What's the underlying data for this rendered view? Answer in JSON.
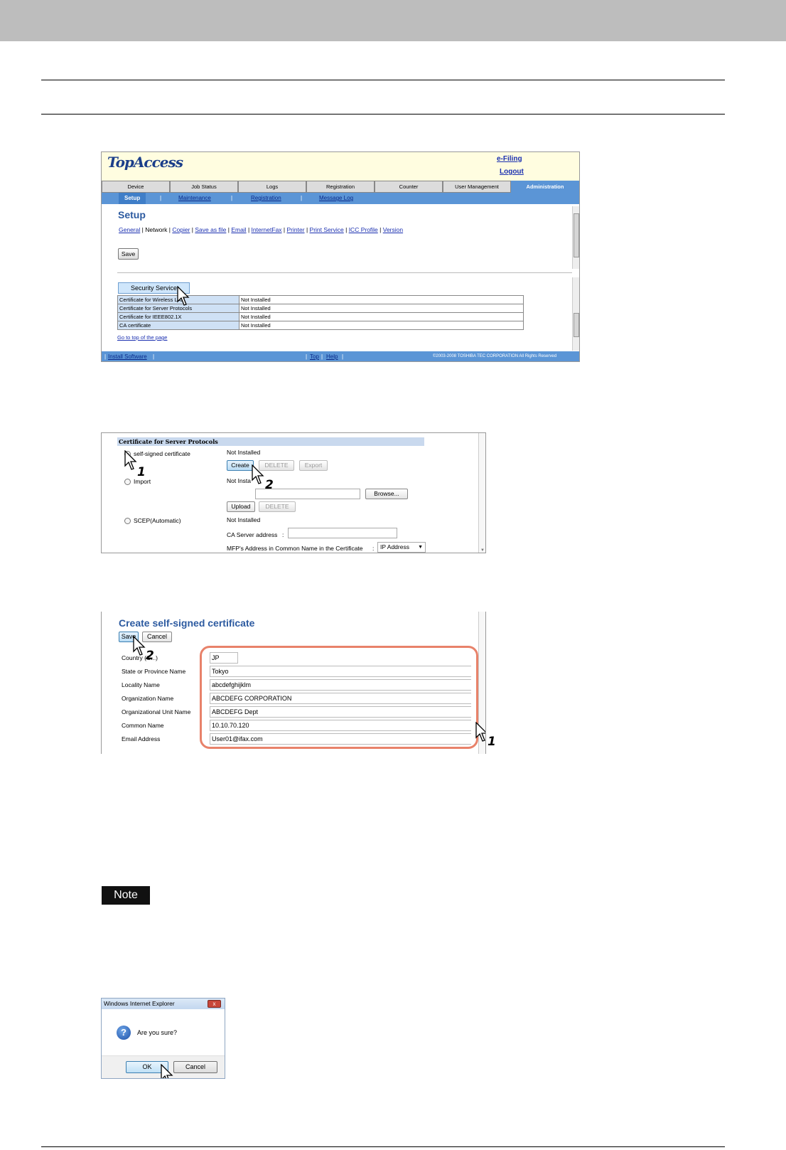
{
  "screen1": {
    "logo": "TopAccess",
    "links": {
      "efiling": "e-Filing",
      "logout": "Logout"
    },
    "tabs": [
      "Device",
      "Job Status",
      "Logs",
      "Registration",
      "Counter",
      "User Management",
      "Administration"
    ],
    "active_tab": "Administration",
    "subnav": {
      "current": "Setup",
      "items": [
        "Maintenance",
        "Registration",
        "Message Log"
      ],
      "sep": "|"
    },
    "page_title": "Setup",
    "menu": {
      "items": [
        "General",
        "Network",
        "Copier",
        "Save as file",
        "Email",
        "InternetFax",
        "Printer",
        "Print Service",
        "ICC Profile",
        "Version"
      ],
      "current": "Network",
      "sep": "|"
    },
    "save_label": "Save",
    "security_button": "Security Service",
    "table": [
      {
        "name": "Certificate for Wireless LAN",
        "status": "Not Installed"
      },
      {
        "name": "Certificate for Server Protocols",
        "status": "Not Installed"
      },
      {
        "name": "Certificate for IEEE802.1X",
        "status": "Not Installed"
      },
      {
        "name": "CA certificate",
        "status": "Not Installed"
      }
    ],
    "go_top": "Go to top of the page",
    "footer": {
      "install": "Install Software",
      "top": "Top",
      "help": "Help",
      "sep": "|",
      "copyright": "©2003-2008 TOSHIBA TEC CORPORATION All Rights Reserved"
    }
  },
  "screen2": {
    "header": "Certificate for Server Protocols",
    "options": [
      "self-signed certificate",
      "Import",
      "SCEP(Automatic)"
    ],
    "status_1": "Not Installed",
    "status_2": "Not Insta",
    "status_3": "Not Installed",
    "buttons_1": [
      "Create",
      "DELETE",
      "Export"
    ],
    "browse": "Browse...",
    "buttons_2": [
      "Upload",
      "DELETE"
    ],
    "ca_label": "CA Server address",
    "colon": ":",
    "mfp_label": "MFP's Address in Common Name in the Certificate",
    "mfp_value": "IP Address",
    "step1": "1",
    "step2": "2"
  },
  "screen3": {
    "title": "Create self-signed certificate",
    "save": "Save",
    "cancel": "Cancel",
    "fields": [
      {
        "label": "Country (C...)",
        "value": "JP"
      },
      {
        "label": "State or Province Name",
        "value": "Tokyo"
      },
      {
        "label": "Locality Name",
        "value": "abcdefghijklm"
      },
      {
        "label": "Organization Name",
        "value": "ABCDEFG CORPORATION"
      },
      {
        "label": "Organizational Unit Name",
        "value": "ABCDEFG Dept"
      },
      {
        "label": "Common Name",
        "value": "10.10.70.120"
      },
      {
        "label": "Email Address",
        "value": "User01@ifax.com"
      }
    ],
    "step1": "1",
    "step2": "2"
  },
  "note": {
    "label": "Note"
  },
  "dialog": {
    "title": "Windows Internet Explorer",
    "close": "x",
    "icon": "?",
    "message": "Are you sure?",
    "ok": "OK",
    "cancel": "Cancel"
  },
  "colors": {
    "accent_blue": "#5b95d6",
    "header_band": "#bdbdbd",
    "highlight": "#e8826a",
    "topaccess_bg": "#fffde0"
  }
}
